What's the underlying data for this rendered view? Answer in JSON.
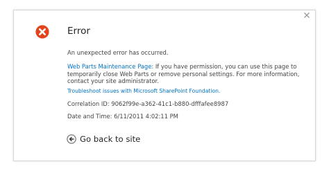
{
  "dialog": {
    "title": "Error",
    "message": "An unexpected error has occurred.",
    "maintenance_link": "Web Parts Maintenance Page:",
    "maintenance_text": " If you have permission, you can use this page to temporarily close Web Parts or remove personal settings. For more information, contact your site administrator.",
    "troubleshoot_link": "Troubleshoot issues with Microsoft SharePoint Foundation.",
    "correlation": "Correlation ID: 9062f99e-a362-41c1-b880-dfffafee8987",
    "datetime": "Date and Time: 6/11/2011 4:02:11 PM",
    "back_label": "Go back to site"
  },
  "icons": {
    "error": "error-icon",
    "close": "close-icon",
    "back": "back-arrow-icon"
  },
  "colors": {
    "error_red": "#e2441b",
    "link": "#0072c6",
    "text": "#444444"
  }
}
